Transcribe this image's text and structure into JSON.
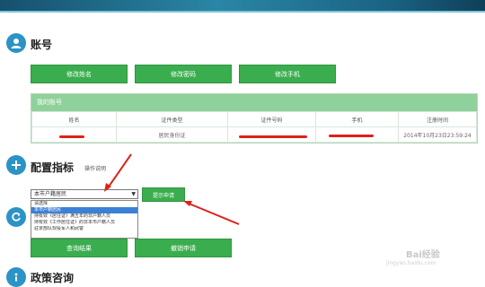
{
  "sections": {
    "account": {
      "title": "账号"
    },
    "config": {
      "title": "配置指标",
      "help_link": "操作说明"
    },
    "policy": {
      "title": "政策咨询"
    }
  },
  "account_buttons": [
    "修改姓名",
    "修改密码",
    "修改手机"
  ],
  "account_table": {
    "caption": "我的账号",
    "columns": [
      "姓名",
      "证件类型",
      "证件号码",
      "手机",
      "注册时间"
    ],
    "row": [
      "",
      "居民身份证",
      "",
      "",
      "2014年10月23日23:59:24"
    ]
  },
  "config": {
    "select_value": "本市户籍居民",
    "apply_button": "提示申请",
    "options": [
      "请选择",
      "本市户籍居民",
      "持有效《居住证》满五年的非户籍人员",
      "持有效《工作居住证》的非本市户籍人员",
      "驻京部队现役军人和武警"
    ]
  },
  "lower_buttons": [
    "查询结果",
    "撤销申请"
  ],
  "watermark": {
    "text": "Bai经验",
    "url": "jingyan.baidu.com"
  },
  "colors": {
    "accent_green": "#3aae4e",
    "icon_blue": "#2c93c5",
    "annotation_red": "#e0201a",
    "header_teal": "#2a86a6"
  }
}
